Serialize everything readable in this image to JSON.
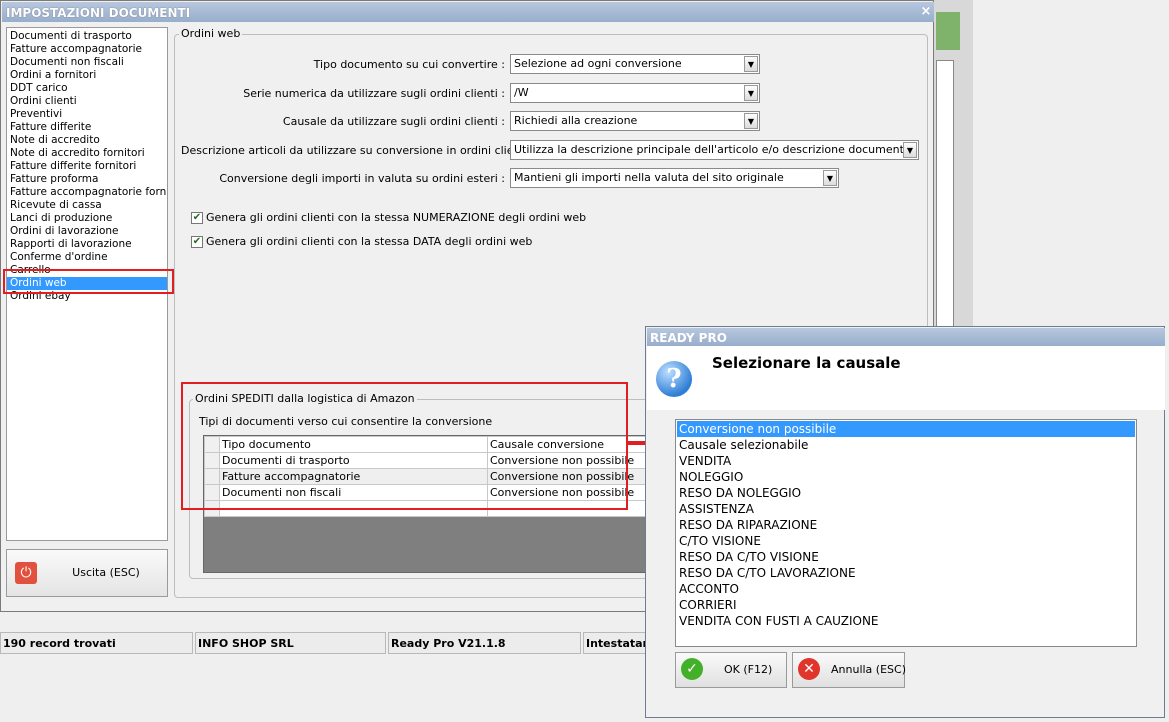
{
  "window": {
    "title": "IMPOSTAZIONI DOCUMENTI",
    "close_glyph": "×"
  },
  "menu": {
    "items": [
      "Documenti di trasporto",
      "Fatture accompagnatorie",
      "Documenti non fiscali",
      "Ordini a fornitori",
      "DDT carico",
      "Ordini clienti",
      "Preventivi",
      "Fatture differite",
      "Note di accredito",
      "Note di accredito fornitori",
      "Fatture differite fornitori",
      "Fatture proforma",
      "Fatture accompagnatorie fornito",
      "Ricevute di cassa",
      "Lanci di produzione",
      "Ordini di lavorazione",
      "Rapporti di lavorazione",
      "Conferme d'ordine",
      "Carrello",
      "Ordini web",
      "Ordini ebay"
    ],
    "selected": "Ordini web"
  },
  "exit_button": {
    "label": "Uscita (ESC)",
    "icon": "power-icon"
  },
  "settings": {
    "group_title": "Ordini web",
    "rows": [
      {
        "label": "Tipo documento su cui convertire :",
        "value": "Selezione ad ogni conversione"
      },
      {
        "label": "Serie numerica da utilizzare sugli ordini clienti :",
        "value": "/W"
      },
      {
        "label": "Causale da utilizzare sugli ordini clienti :",
        "value": "Richiedi alla creazione"
      },
      {
        "label": "Descrizione articoli da utilizzare su conversione in ordini clienti :",
        "value": "Utilizza la descrizione principale dell'articolo e/o descrizione documenti"
      },
      {
        "label": "Conversione degli importi in valuta su ordini esteri :",
        "value": "Mantieni gli importi nella valuta del sito originale"
      }
    ],
    "checkboxes": [
      {
        "label": "Genera gli ordini clienti con la stessa NUMERAZIONE degli ordini web",
        "checked": true
      },
      {
        "label": "Genera gli ordini clienti con la stessa DATA degli ordini web",
        "checked": true
      }
    ]
  },
  "amazon": {
    "group_title": "Ordini SPEDITI dalla logistica di Amazon",
    "subtitle": "Tipi di documenti verso cui consentire la conversione",
    "columns": [
      "Tipo documento",
      "Causale conversione"
    ],
    "rows": [
      [
        "Documenti di trasporto",
        "Conversione non possibile"
      ],
      [
        "Fatture accompagnatorie",
        "Conversione non possibile"
      ],
      [
        "Documenti non fiscali",
        "Conversione non possibile"
      ]
    ]
  },
  "status_bar": {
    "records": "190 record trovati",
    "company": "INFO SHOP SRL",
    "version": "Ready Pro V21.1.8",
    "holder": "Intestatari"
  },
  "dialog": {
    "title": "READY PRO",
    "prompt": "Selezionare la causale",
    "icon": "question-icon",
    "items": [
      "Conversione non possibile",
      "Causale selezionabile",
      "VENDITA",
      "NOLEGGIO",
      "RESO DA NOLEGGIO",
      "ASSISTENZA",
      "RESO DA RIPARAZIONE",
      "C/TO VISIONE",
      "RESO DA C/TO VISIONE",
      "RESO DA C/TO LAVORAZIONE",
      "ACCONTO",
      "CORRIERI",
      "VENDITA CON FUSTI A CAUZIONE"
    ],
    "selected_index": 0,
    "ok_label": "OK (F12)",
    "cancel_label": "Annulla (ESC)"
  },
  "colors": {
    "selection": "#3399ff",
    "highlight_box": "#e02020",
    "title_bar": "#97aecb"
  }
}
